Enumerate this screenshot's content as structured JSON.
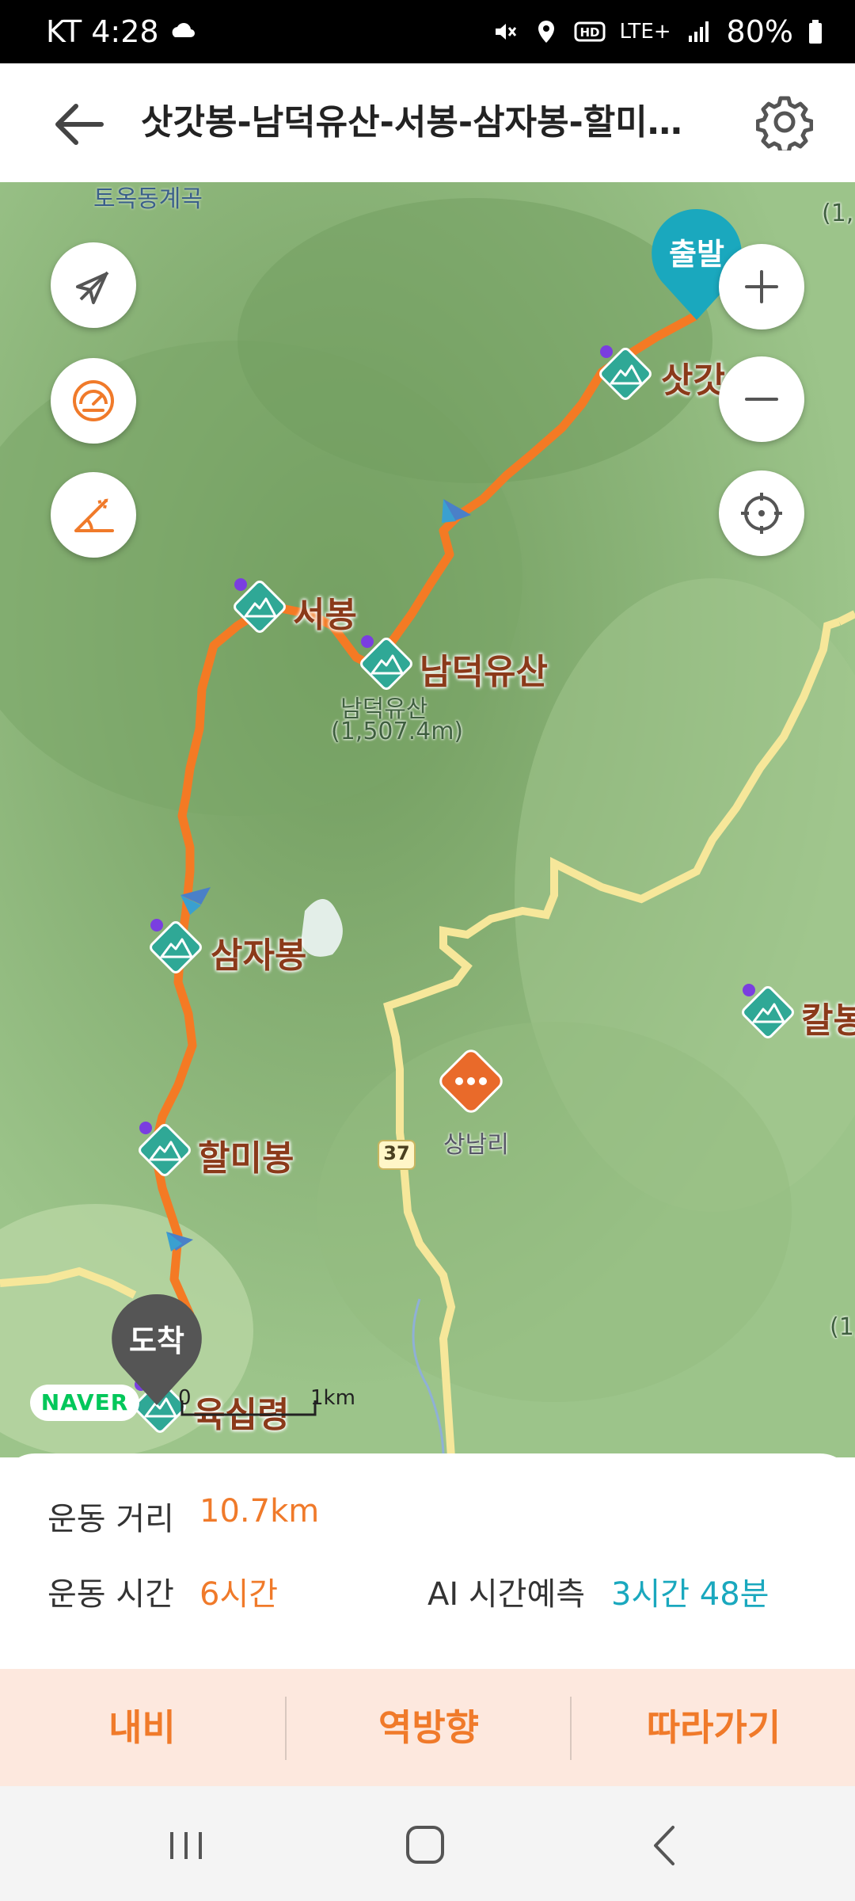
{
  "status_bar": {
    "carrier_time": "KT 4:28",
    "network": "LTE+",
    "battery": "80%"
  },
  "header": {
    "title": "삿갓봉-남덕유산-서봉-삼자봉-할미봉..."
  },
  "map": {
    "places": {
      "valley": "토옥동계곡",
      "peak_satgat": "삿갓",
      "peak_seobong": "서봉",
      "peak_namdeok": "남덕유산",
      "peak_namdeok_sub": "남덕유산",
      "peak_namdeok_elev": "(1,507.4m)",
      "peak_samja": "삼자봉",
      "peak_halmi": "할미봉",
      "peak_kalbong": "칼봉",
      "pass_yuksin": "육십령",
      "village": "상남리",
      "road_number": "37",
      "edge_label_top": "(1,",
      "edge_label_bottom": "(1,"
    },
    "start_badge": "출발",
    "end_badge": "도착",
    "logo": "NAVER",
    "scale_start": "0",
    "scale_end": "1km"
  },
  "stats": {
    "distance_label": "운동 거리",
    "distance_value": "10.7km",
    "time_label": "운동 시간",
    "time_value": "6시간",
    "ai_label": "AI 시간예측",
    "ai_value": "3시간 48분"
  },
  "actions": {
    "navigate": "내비",
    "reverse": "역방향",
    "follow": "따라가기"
  },
  "colors": {
    "route": "#f47a24",
    "accent": "#f07a2a",
    "teal": "#1aa8be",
    "peak_green": "#2fa896"
  }
}
